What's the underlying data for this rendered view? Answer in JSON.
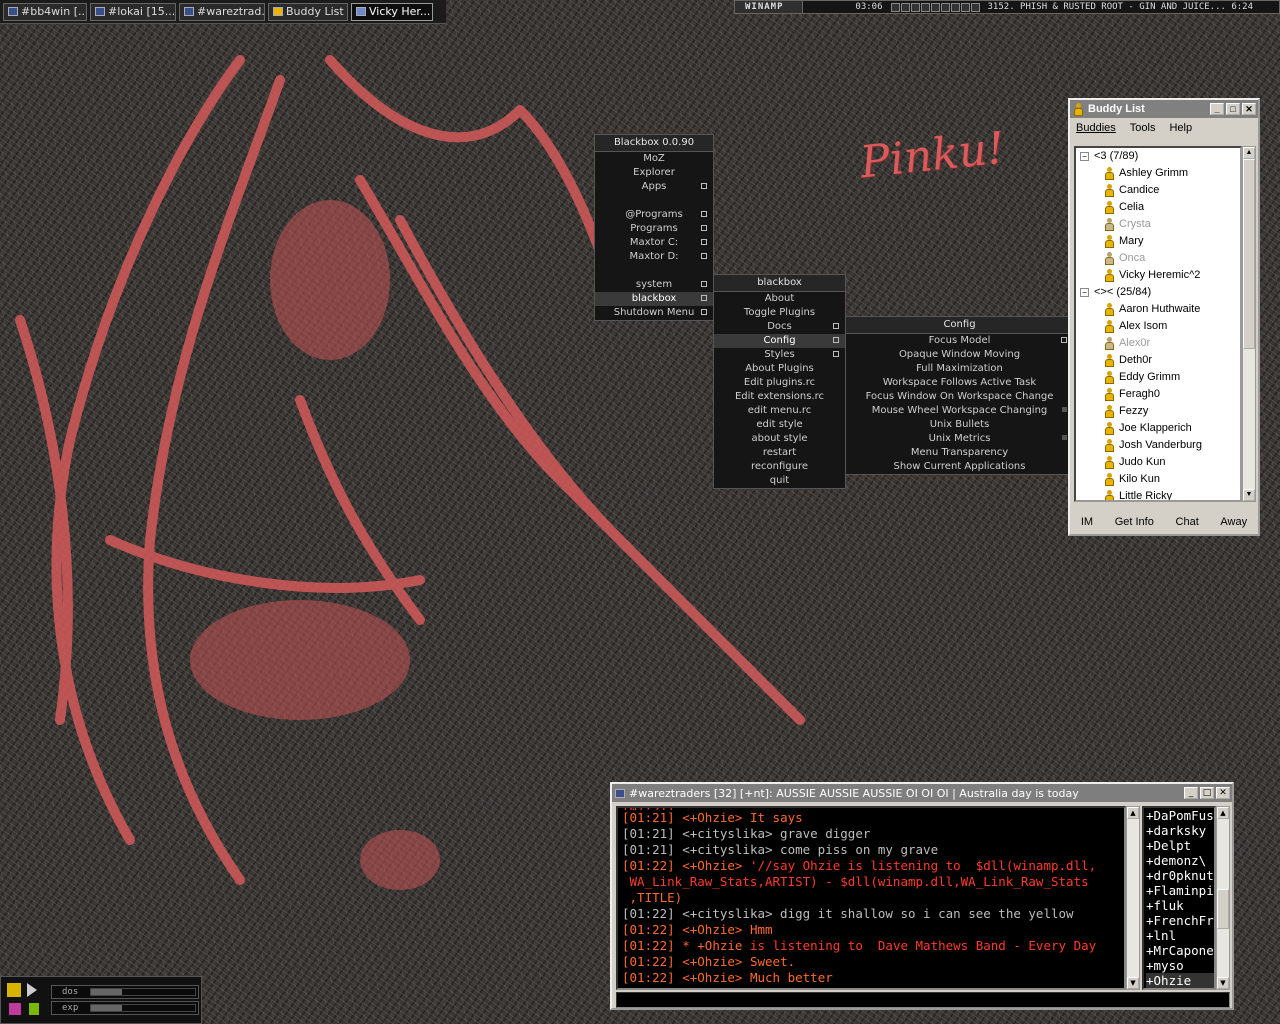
{
  "taskbar": {
    "tasks": [
      "#bb4win [...",
      "#lokai [15...",
      "#wareztrad...",
      "Buddy List",
      "Vicky Her..."
    ]
  },
  "winamp": {
    "logo": "WINAMP",
    "time": "03:06",
    "song": "3152. PHISH & RUSTED ROOT - GIN AND JUICE... 6:24"
  },
  "wallpaper": {
    "text": "Pinku!"
  },
  "main_menu": {
    "title": "Blackbox 0.0.90",
    "items": [
      "MoZ",
      "Explorer",
      "Apps",
      "",
      "@Programs",
      "Programs",
      "Maxtor C:",
      "Maxtor D:",
      "",
      "system",
      "blackbox",
      "Shutdown Menu"
    ]
  },
  "blackbox_menu": {
    "title": "blackbox",
    "items": [
      "About",
      "Toggle Plugins",
      "Docs",
      "Config",
      "Styles",
      "About Plugins",
      "Edit plugins.rc",
      "Edit extensions.rc",
      "edit menu.rc",
      "edit style",
      "about style",
      "restart",
      "reconfigure",
      "quit"
    ]
  },
  "config_menu": {
    "title": "Config",
    "items": [
      "Focus Model",
      "Opaque Window Moving",
      "Full Maximization",
      "Workspace Follows Active Task",
      "Focus Window On Workspace Change",
      "Mouse Wheel Workspace Changing",
      "Unix Bullets",
      "Unix Metrics",
      "Menu Transparency",
      "Show Current Applications"
    ]
  },
  "buddy_list": {
    "title": "Buddy List",
    "menus": [
      "Buddies",
      "Tools",
      "Help"
    ],
    "groups": [
      {
        "name": "<3 (7/89)",
        "buddies": [
          "Ashley Grimm",
          "Candice",
          "Celia",
          "Crysta",
          "Mary",
          "Onca",
          "Vicky Heremic^2"
        ]
      },
      {
        "name": "<>< (25/84)",
        "buddies": [
          "Aaron Huthwaite",
          "Alex Isom",
          "Alex0r",
          "Deth0r",
          "Eddy Grimm",
          "Feragh0",
          "Fezzy",
          "Joe Klapperich",
          "Josh Vanderburg",
          "Judo Kun",
          "Kilo Kun",
          "Little Ricky"
        ]
      }
    ],
    "idle": [
      "Crysta",
      "Onca",
      "Alex0r"
    ],
    "actions": [
      "IM",
      "Get Info",
      "Chat",
      "Away"
    ]
  },
  "irc": {
    "title": "#wareztraders [32] [+nt]: AUSSIE AUSSIE AUSSIE OI OI OI | Australia day is today",
    "lines": [
      {
        "ts": "[01:21]",
        "nick": "<+Ohzie>",
        "msg": " It says",
        "color": "or"
      },
      {
        "ts": "[01:21]",
        "nick": "<+cityslika>",
        "msg": " grave digger",
        "color": "gy"
      },
      {
        "ts": "[01:21]",
        "nick": "<+cityslika>",
        "msg": " come piss on my grave",
        "color": "gy"
      },
      {
        "ts": "[01:22]",
        "nick": "<+Ohzie>",
        "msg": " '//say Ohzie is listening to  $dll(winamp.dll,",
        "color": "or"
      },
      {
        "ts": "",
        "nick": "",
        "msg": " WA_Link_Raw_Stats,ARTIST) - $dll(winamp.dll,WA_Link_Raw_Stats",
        "color": "or"
      },
      {
        "ts": "",
        "nick": "",
        "msg": " ,TITLE)",
        "color": "or"
      },
      {
        "ts": "[01:22]",
        "nick": "<+cityslika>",
        "msg": " digg it shallow so i can see the yellow",
        "color": "gy"
      },
      {
        "ts": "[01:22]",
        "nick": "<+Ohzie>",
        "msg": " Hmm",
        "color": "or"
      },
      {
        "ts": "[01:22]",
        "nick": "* +Ohzie",
        "msg": " is listening to  Dave Mathews Band - Every Day",
        "color": "or"
      },
      {
        "ts": "[01:22]",
        "nick": "<+Ohzie>",
        "msg": " Sweet.",
        "color": "or"
      },
      {
        "ts": "[01:22]",
        "nick": "<+Ohzie>",
        "msg": " Much better",
        "color": "or"
      }
    ],
    "nicks": [
      "+DaPomFus",
      "+darksky",
      "+Delpt",
      "+demonz\\",
      "+dr0pknut",
      "+Flaminpi",
      "+fluk",
      "+FrenchFr",
      "+lnl",
      "+MrCapone",
      "+myso",
      "+Ohzie"
    ]
  },
  "dock": {
    "labels": [
      "dos",
      "exp"
    ],
    "levels": [
      0.3,
      0.3
    ]
  }
}
